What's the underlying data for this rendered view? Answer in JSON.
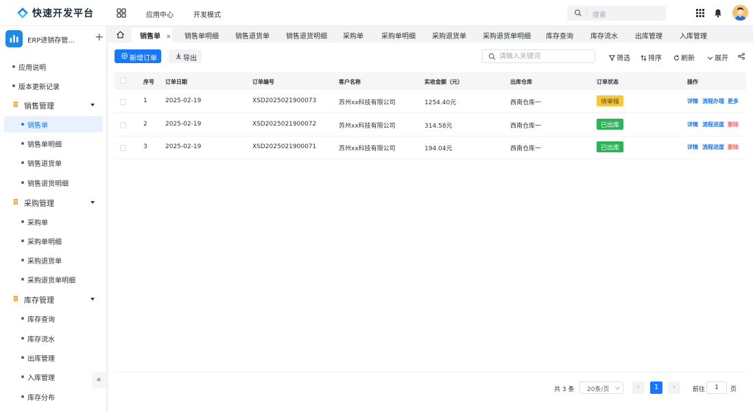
{
  "app": {
    "title": "快速开发平台"
  },
  "topnav": {
    "items": [
      "应用中心",
      "开发模式"
    ]
  },
  "search": {
    "placeholder": "搜索"
  },
  "sidebar": {
    "project_name": "ERP进销存管...",
    "items": [
      {
        "label": "应用说明"
      },
      {
        "label": "版本更新记录"
      }
    ],
    "groups": [
      {
        "label": "销售管理",
        "color": "#f5a623",
        "items": [
          "销售单",
          "销售单明细",
          "销售退货单",
          "销售退货明细"
        ]
      },
      {
        "label": "采购管理",
        "color": "#f5a623",
        "items": [
          "采购单",
          "采购单明细",
          "采购退货单",
          "采购退货单明细"
        ]
      },
      {
        "label": "库存管理",
        "color": "#f5a623",
        "items": [
          "库存查询",
          "库存流水",
          "出库管理",
          "入库管理",
          "库存分布"
        ]
      }
    ],
    "active_item": "销售单",
    "collapse_label": "«"
  },
  "tabs": {
    "active": "销售单",
    "close_glyph": "×",
    "items": [
      "销售单",
      "销售单明细",
      "销售退货单",
      "销售退货明细",
      "采购单",
      "采购单明细",
      "采购退货单",
      "采购退货单明细",
      "库存查询",
      "库存流水",
      "出库管理",
      "入库管理"
    ]
  },
  "toolbar": {
    "add_label": "新增订单",
    "export_label": "导出",
    "keyword_placeholder": "请输入关键词",
    "filter_label": "筛选",
    "sort_label": "排序",
    "refresh_label": "刷新",
    "expand_label": "展开"
  },
  "table": {
    "columns": [
      "序号",
      "订单日期",
      "订单编号",
      "客户名称",
      "实收金额（元）",
      "出库仓库",
      "订单状态",
      "操作"
    ],
    "rows": [
      {
        "index": "1",
        "date": "2025-02-19",
        "order_no": "XSD2025021900073",
        "customer": "苏州xx科技有限公司",
        "amount": "1254.40元",
        "warehouse": "西南仓库一",
        "status": "待审核",
        "status_color": "#f7c83f",
        "status_text_color": "#5a4400",
        "actions": [
          "详情",
          "流程办理",
          "更多"
        ]
      },
      {
        "index": "2",
        "date": "2025-02-19",
        "order_no": "XSD2025021900072",
        "customer": "苏州xx科技有限公司",
        "amount": "314.58元",
        "warehouse": "西南仓库一",
        "status": "已出库",
        "status_color": "#2fb35a",
        "status_text_color": "#ffffff",
        "actions": [
          "详情",
          "流程进度",
          "删除"
        ]
      },
      {
        "index": "3",
        "date": "2025-02-19",
        "order_no": "XSD2025021900071",
        "customer": "苏州xx科技有限公司",
        "amount": "194.04元",
        "warehouse": "西南仓库一",
        "status": "已出库",
        "status_color": "#2fb35a",
        "status_text_color": "#ffffff",
        "actions": [
          "详情",
          "流程进度",
          "删除"
        ]
      }
    ]
  },
  "pagination": {
    "total_text": "共 3 条",
    "page_size": "20条/页",
    "prev": "‹",
    "current_page": "1",
    "next": "›",
    "goto_label": "前往",
    "goto_value": "1",
    "page_suffix": "页"
  },
  "colors": {
    "primary": "#1677ff",
    "danger": "#f56c6c",
    "link": "#1677ff"
  }
}
